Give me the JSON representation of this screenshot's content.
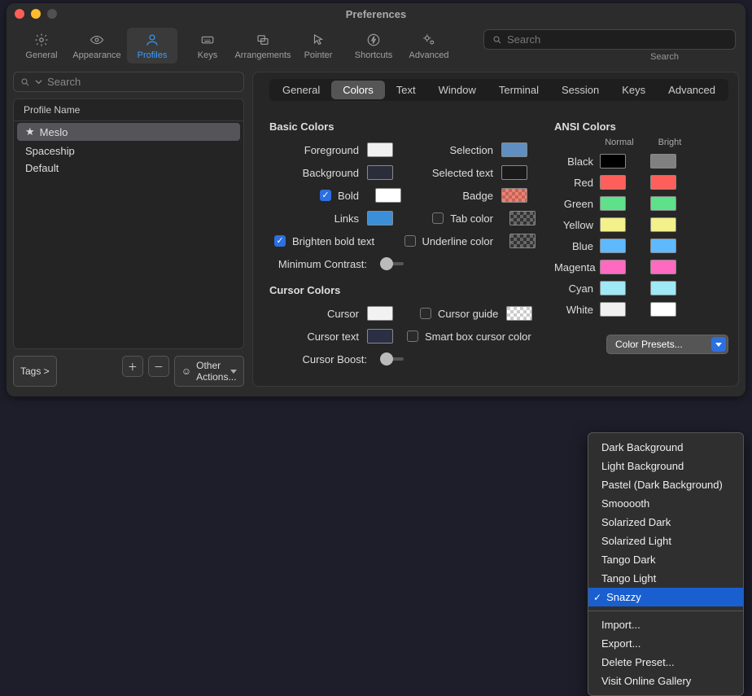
{
  "window": {
    "title": "Preferences"
  },
  "toolbar": {
    "items": [
      {
        "label": "General"
      },
      {
        "label": "Appearance"
      },
      {
        "label": "Profiles"
      },
      {
        "label": "Keys"
      },
      {
        "label": "Arrangements"
      },
      {
        "label": "Pointer"
      },
      {
        "label": "Shortcuts"
      },
      {
        "label": "Advanced"
      }
    ],
    "search_placeholder": "Search",
    "search_label": "Search"
  },
  "sidebar": {
    "search_placeholder": "Search",
    "header": "Profile Name",
    "profiles": [
      {
        "name": "Meslo",
        "starred": true
      },
      {
        "name": "Spaceship",
        "starred": false
      },
      {
        "name": "Default",
        "starred": false
      }
    ],
    "tags_label": "Tags >",
    "other_actions": "Other Actions..."
  },
  "subtabs": [
    "General",
    "Colors",
    "Text",
    "Window",
    "Terminal",
    "Session",
    "Keys",
    "Advanced"
  ],
  "basic": {
    "title": "Basic Colors",
    "foreground": "Foreground",
    "background": "Background",
    "bold": "Bold",
    "links": "Links",
    "brighten": "Brighten bold text",
    "min_contrast": "Minimum Contrast:",
    "selection": "Selection",
    "selected_text": "Selected text",
    "badge": "Badge",
    "tab_color": "Tab color",
    "underline_color": "Underline color",
    "colors": {
      "foreground": "#f0f0f0",
      "background": "#2b2d3a",
      "bold": "#ffffff",
      "links": "#3b8fd8",
      "selection": "#5f8fc0",
      "selected_text": "#1a1a1a",
      "badge": "#f08070"
    }
  },
  "cursor": {
    "title": "Cursor Colors",
    "cursor": "Cursor",
    "cursor_text": "Cursor text",
    "cursor_boost": "Cursor Boost:",
    "cursor_guide": "Cursor guide",
    "smart_box": "Smart box cursor color",
    "colors": {
      "cursor": "#f2f2f2",
      "cursor_text": "#2c2e44"
    }
  },
  "ansi": {
    "title": "ANSI Colors",
    "normal": "Normal",
    "bright": "Bright",
    "rows": [
      {
        "label": "Black",
        "normal": "#000000",
        "bright": "#808080"
      },
      {
        "label": "Red",
        "normal": "#ff5f5a",
        "bright": "#ff5f5a"
      },
      {
        "label": "Green",
        "normal": "#5fe08a",
        "bright": "#5fe08a"
      },
      {
        "label": "Yellow",
        "normal": "#f2f18a",
        "bright": "#f2f18a"
      },
      {
        "label": "Blue",
        "normal": "#5fb9ff",
        "bright": "#5fb9ff"
      },
      {
        "label": "Magenta",
        "normal": "#ff6ac1",
        "bright": "#ff6ac1"
      },
      {
        "label": "Cyan",
        "normal": "#9fe8f5",
        "bright": "#9fe8f5"
      },
      {
        "label": "White",
        "normal": "#f0f0f0",
        "bright": "#ffffff"
      }
    ]
  },
  "preset": {
    "button": "Color Presets...",
    "items": [
      "Dark Background",
      "Light Background",
      "Pastel (Dark Background)",
      "Smooooth",
      "Solarized Dark",
      "Solarized Light",
      "Tango Dark",
      "Tango Light"
    ],
    "selected": "Snazzy",
    "actions": [
      "Import...",
      "Export...",
      "Delete Preset...",
      "Visit Online Gallery"
    ]
  }
}
